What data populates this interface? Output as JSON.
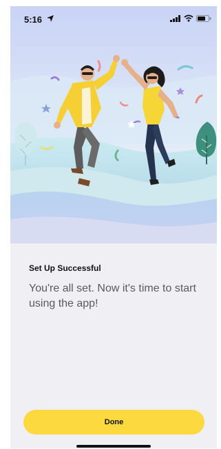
{
  "status_bar": {
    "time": "5:16",
    "icons": [
      "location-arrow-icon",
      "cellular-signal-icon",
      "wifi-icon",
      "battery-icon"
    ]
  },
  "illustration": {
    "subject": "high-five-couple-illustration"
  },
  "content": {
    "title": "Set Up Successful",
    "message": "You're all set. Now it's time to start using the app!"
  },
  "actions": {
    "done_label": "Done"
  },
  "colors": {
    "accent": "#fbd93f",
    "background": "#f0eff4",
    "text_primary": "#111111",
    "text_secondary": "#5a5a5a"
  }
}
